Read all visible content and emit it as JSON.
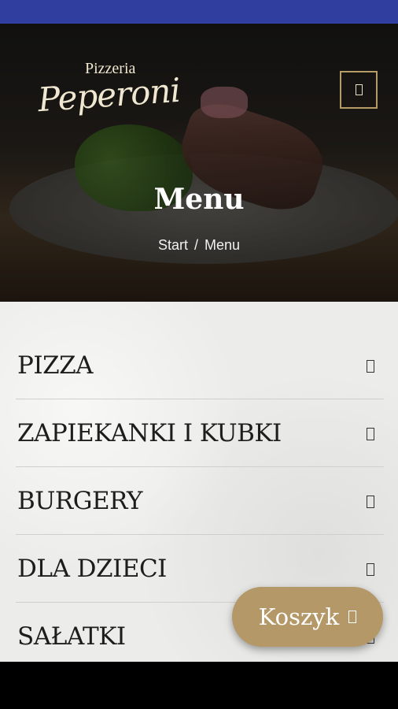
{
  "brand": {
    "line1": "Pizzeria",
    "line2": "Peperoni"
  },
  "header": {
    "menu_icon": "hamburger-menu-icon"
  },
  "page": {
    "title": "Menu"
  },
  "breadcrumb": {
    "home": "Start",
    "separator": "/",
    "current": "Menu"
  },
  "categories": [
    {
      "label": "PIZZA",
      "icon": "chevron-down-icon"
    },
    {
      "label": "ZAPIEKANKI I KUBKI",
      "icon": "chevron-down-icon"
    },
    {
      "label": "BURGERY",
      "icon": "chevron-down-icon"
    },
    {
      "label": "DLA DZIECI",
      "icon": "chevron-down-icon"
    },
    {
      "label": "SAŁATKI",
      "icon": "chevron-down-icon"
    }
  ],
  "cart": {
    "label": "Koszyk",
    "icon": "cart-icon"
  },
  "colors": {
    "status_bar": "#303f9f",
    "accent": "#b49868",
    "menu_border": "#b79b67",
    "text_dark": "#1d1d1d"
  }
}
